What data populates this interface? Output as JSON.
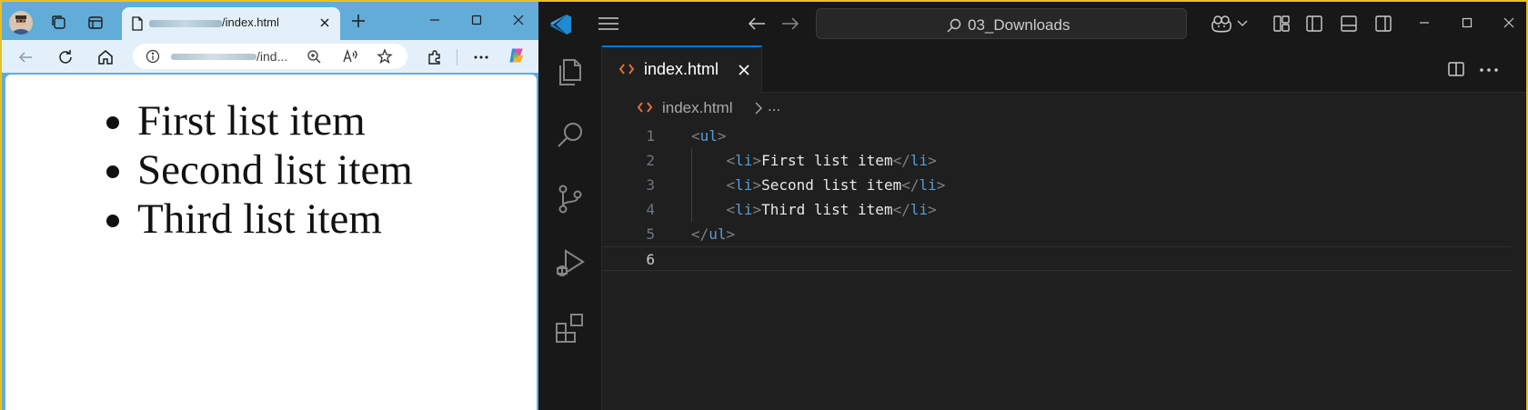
{
  "browser": {
    "tab_title": "/index.html",
    "address_url": "/ind...",
    "page_list": [
      "First list item",
      "Second list item",
      "Third list item"
    ],
    "accent_color": "#62acd8"
  },
  "vscode": {
    "search_text": "03_Downloads",
    "tab": {
      "filename": "index.html"
    },
    "breadcrumb": {
      "file": "index.html",
      "more": "..."
    },
    "code_lines": [
      {
        "num": "1",
        "parts": [
          [
            "br",
            "<"
          ],
          [
            "tag",
            "ul"
          ],
          [
            "br",
            ">"
          ]
        ]
      },
      {
        "num": "2",
        "parts": [
          [
            "sp",
            "    "
          ],
          [
            "br",
            "<"
          ],
          [
            "tag",
            "li"
          ],
          [
            "br",
            ">"
          ],
          [
            "txt",
            "First list item"
          ],
          [
            "br",
            "</"
          ],
          [
            "tag",
            "li"
          ],
          [
            "br",
            ">"
          ]
        ]
      },
      {
        "num": "3",
        "parts": [
          [
            "sp",
            "    "
          ],
          [
            "br",
            "<"
          ],
          [
            "tag",
            "li"
          ],
          [
            "br",
            ">"
          ],
          [
            "txt",
            "Second list item"
          ],
          [
            "br",
            "</"
          ],
          [
            "tag",
            "li"
          ],
          [
            "br",
            ">"
          ]
        ]
      },
      {
        "num": "4",
        "parts": [
          [
            "sp",
            "    "
          ],
          [
            "br",
            "<"
          ],
          [
            "tag",
            "li"
          ],
          [
            "br",
            ">"
          ],
          [
            "txt",
            "Third list item"
          ],
          [
            "br",
            "</"
          ],
          [
            "tag",
            "li"
          ],
          [
            "br",
            ">"
          ]
        ]
      },
      {
        "num": "5",
        "parts": [
          [
            "br",
            "</"
          ],
          [
            "tag",
            "ul"
          ],
          [
            "br",
            ">"
          ]
        ]
      },
      {
        "num": "6",
        "parts": []
      }
    ],
    "colors": {
      "tag": "#569cd6",
      "bracket": "#808080",
      "text": "#e8e8e8",
      "tab_accent": "#0078d4",
      "file_icon": "#e2703a"
    }
  },
  "icons": {
    "browser": [
      "avatar",
      "workspaces-icon",
      "tab-actions-icon",
      "document-icon",
      "close-icon",
      "plus-icon",
      "minimize-icon",
      "maximize-icon",
      "back-icon",
      "refresh-icon",
      "home-icon",
      "info-icon",
      "zoom-icon",
      "read-aloud-icon",
      "favorite-star-icon",
      "extensions-icon",
      "more-icon",
      "copilot-icon"
    ],
    "vscode": [
      "vscode-logo-icon",
      "hamburger-menu-icon",
      "arrow-left-icon",
      "arrow-right-icon",
      "search-icon",
      "copilot-icon",
      "layout-icon",
      "toggle-primary-sidebar-icon",
      "toggle-panel-icon",
      "toggle-secondary-sidebar-icon",
      "explorer-icon",
      "search-view-icon",
      "source-control-icon",
      "run-debug-icon",
      "extensions-icon",
      "split-editor-icon",
      "more-actions-icon"
    ]
  }
}
